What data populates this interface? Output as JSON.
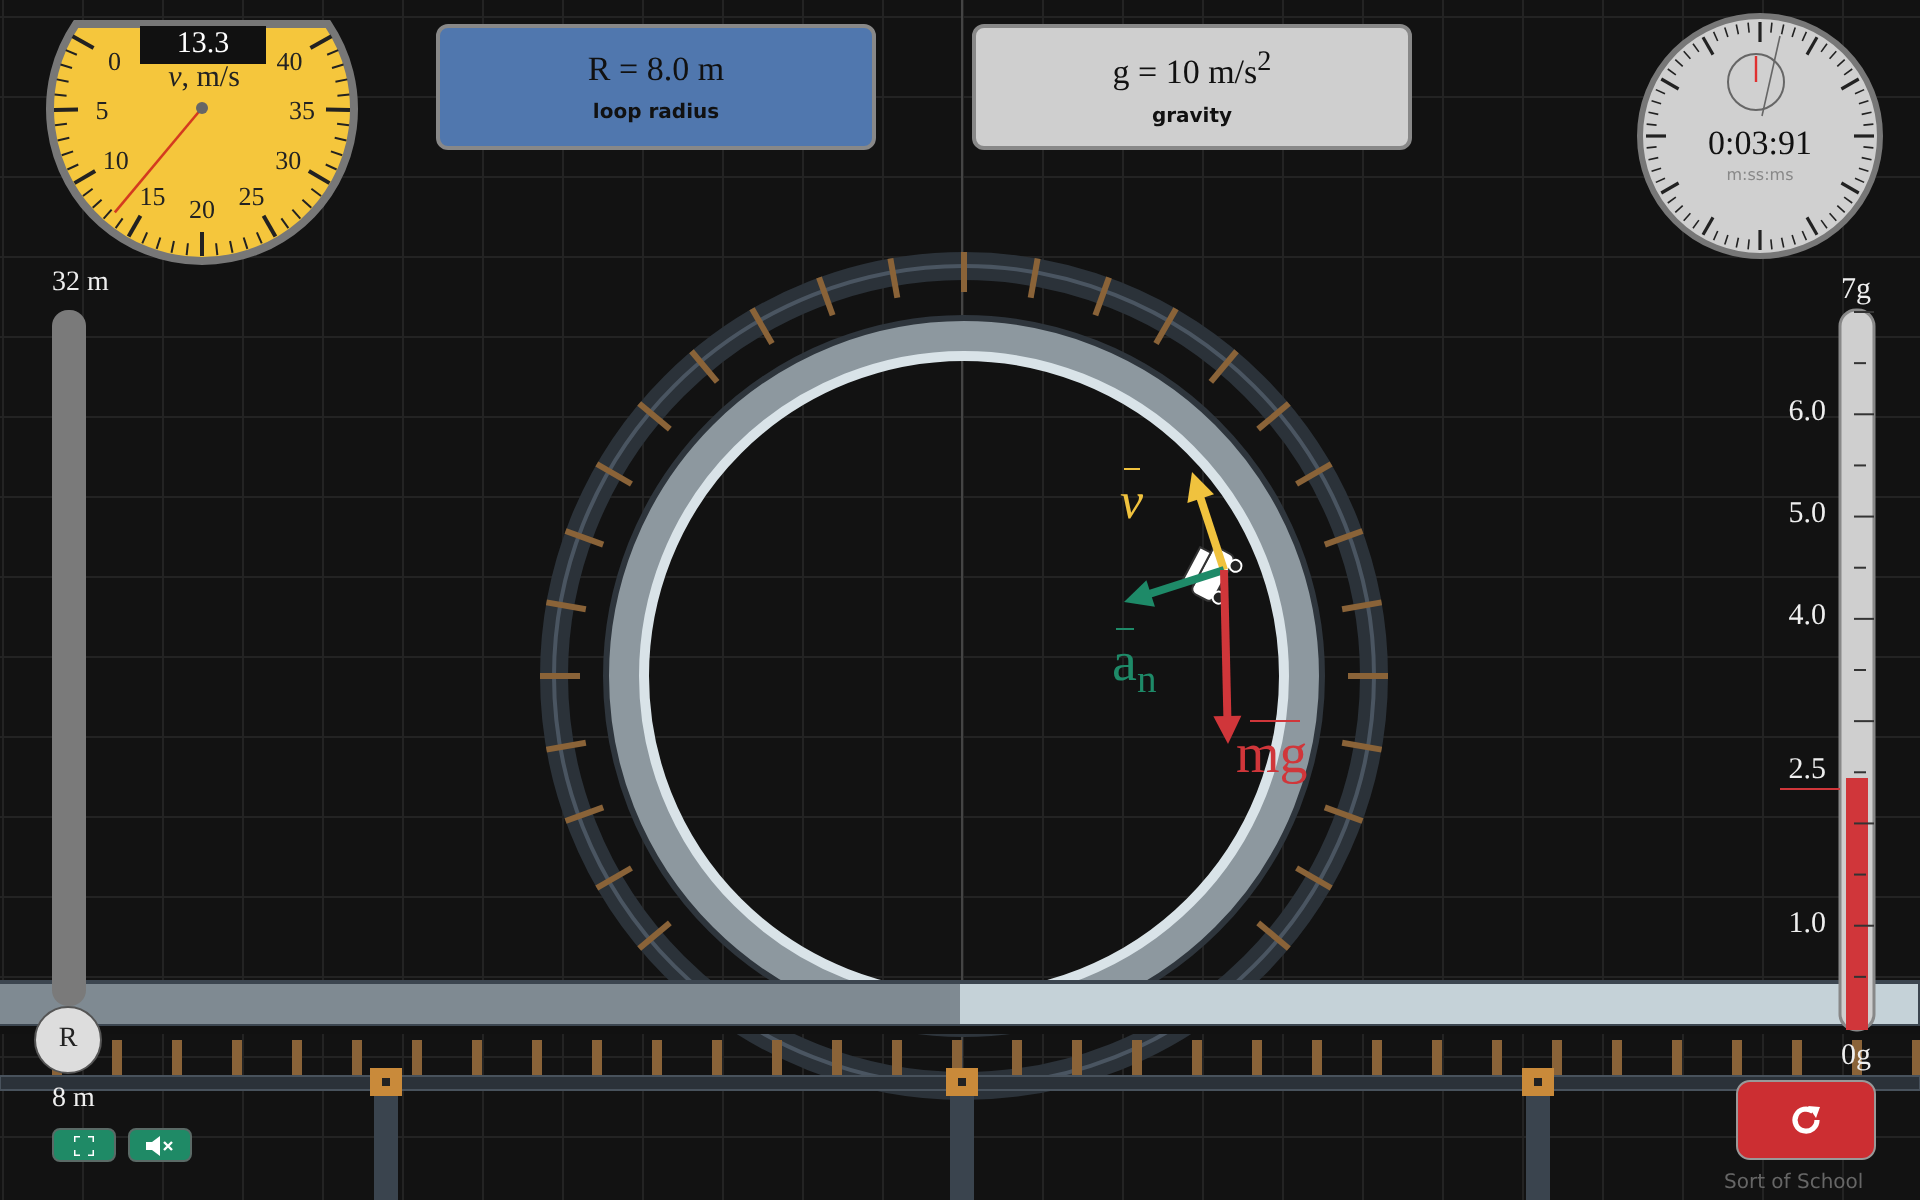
{
  "speedometer": {
    "reading": "13.3",
    "label": "*v*, m/s",
    "ticks": [
      "0",
      "5",
      "10",
      "15",
      "20",
      "25",
      "30",
      "35",
      "40"
    ]
  },
  "radius_panel": {
    "formula": "R = 8.0 m",
    "caption": "loop radius",
    "selected": true
  },
  "gravity_panel": {
    "formula": "g = 10 m/s$^{2}$",
    "caption": "gravity",
    "selected": false
  },
  "stopwatch": {
    "time": "0:03:91",
    "format": "m:ss:ms"
  },
  "radius_slider": {
    "max_label": "32 m",
    "min_label": "8 m",
    "handle": "R",
    "level": 0
  },
  "vectors": [
    {
      "kind": "velocity",
      "label": "v",
      "color": "#f0c23e"
    },
    {
      "kind": "normal",
      "label": "a",
      "subscript": "n",
      "color": "#1e8a68"
    },
    {
      "kind": "gravity",
      "label": "mg",
      "color": "#d0363a"
    }
  ],
  "g_meter": {
    "top_label": "7g",
    "bottom_label": "0g",
    "ticks": [
      {
        "label": "6.0",
        "marked": false
      },
      {
        "label": "5.0",
        "marked": false
      },
      {
        "label": "4.0",
        "marked": false
      },
      {
        "label": "2.5",
        "marked": true
      },
      {
        "label": "1.0",
        "marked": false
      }
    ],
    "level": 0.35
  },
  "footer": "Sort of School"
}
